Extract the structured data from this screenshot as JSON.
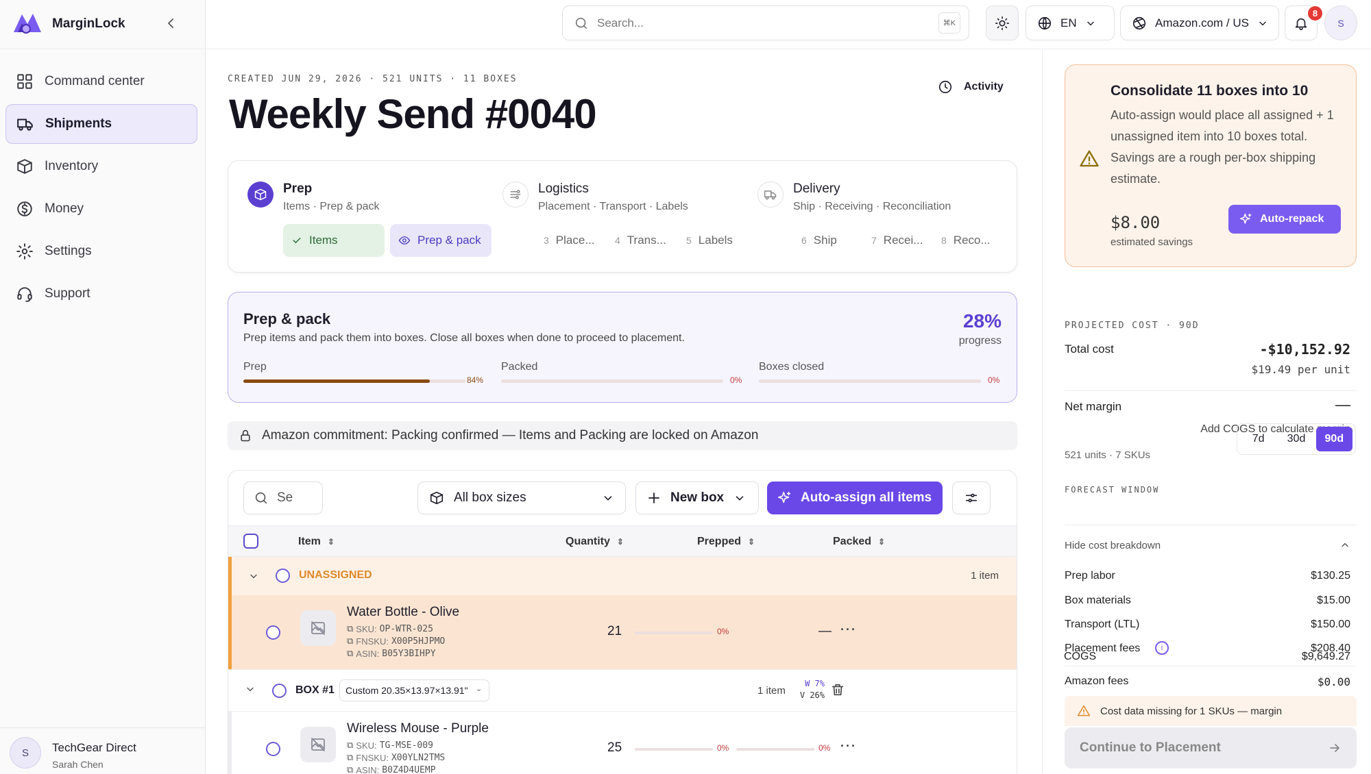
{
  "brand": {
    "name": "MarginLock"
  },
  "nav": {
    "items": [
      {
        "label": "Command center",
        "icon": "grid-icon"
      },
      {
        "label": "Shipments",
        "icon": "truck-icon",
        "active": true
      },
      {
        "label": "Inventory",
        "icon": "box-icon"
      },
      {
        "label": "Money",
        "icon": "dollar-icon"
      },
      {
        "label": "Settings",
        "icon": "gear-icon"
      },
      {
        "label": "Support",
        "icon": "headset-icon"
      }
    ]
  },
  "workspace": {
    "initial": "S",
    "name": "TechGear Direct",
    "user": "Sarah Chen"
  },
  "topbar": {
    "search_placeholder": "Search...",
    "search_kbd": "⌘K",
    "language": "EN",
    "marketplace": "Amazon.com / US",
    "notifications": "8",
    "user_initial": "S"
  },
  "shipment": {
    "meta": "CREATED JUN 29, 2026 · 521 UNITS · 11 BOXES",
    "title": "Weekly Send #0040",
    "activity_label": "Activity"
  },
  "stepper": {
    "stages": [
      {
        "title": "Prep",
        "sub": "Items · Prep & pack"
      },
      {
        "title": "Logistics",
        "sub": "Placement · Transport · Labels"
      },
      {
        "title": "Delivery",
        "sub": "Ship · Receiving · Reconciliation"
      }
    ],
    "steps": [
      {
        "num": "",
        "label": "Items",
        "state": "done"
      },
      {
        "num": "",
        "label": "Prep & pack",
        "state": "current"
      },
      {
        "num": "3",
        "label": "Place..."
      },
      {
        "num": "4",
        "label": "Trans..."
      },
      {
        "num": "5",
        "label": "Labels"
      },
      {
        "num": "6",
        "label": "Ship"
      },
      {
        "num": "7",
        "label": "Recei..."
      },
      {
        "num": "8",
        "label": "Reco..."
      }
    ]
  },
  "prep_pack": {
    "title": "Prep & pack",
    "description": "Prep items and pack them into boxes. Close all boxes when done to proceed to placement.",
    "percent": "28%",
    "percent_label": "progress",
    "bars": [
      {
        "label": "Prep",
        "value": 0.84,
        "display": "84%"
      },
      {
        "label": "Packed",
        "value": 0,
        "display": "0%"
      },
      {
        "label": "Boxes closed",
        "value": 0,
        "display": "0%"
      }
    ]
  },
  "commitment": "Amazon commitment: Packing confirmed — Items and Packing are locked on Amazon",
  "toolbar": {
    "search_value": "Se",
    "box_sizes": "All box sizes",
    "new_box": "New box",
    "auto_assign": "Auto-assign all items"
  },
  "table": {
    "headers": [
      "Item",
      "Quantity",
      "Prepped",
      "Packed"
    ],
    "unassigned": {
      "label": "UNASSIGNED",
      "count": "1 item"
    },
    "rows_unassigned": [
      {
        "name": "Water Bottle - Olive",
        "sku": "OP-WTR-025",
        "fnsku": "X00P5HJPMO",
        "asin": "B05Y3BIHPY",
        "qty": "21",
        "prepped": "0%",
        "packed": "—"
      }
    ],
    "box1": {
      "label": "BOX #1",
      "size": "Custom 20.35×13.97×13.91\"",
      "count": "1 item",
      "w": "W 7%",
      "v": "V 26%"
    },
    "rows_box1": [
      {
        "name": "Wireless Mouse - Purple",
        "sku": "TG-MSE-009",
        "fnsku": "X00YLN2TMS",
        "asin": "B0Z4D4UEMP",
        "qty": "25",
        "prepped": "0%",
        "packed": "0%"
      }
    ],
    "labels": {
      "sku": "SKU:",
      "fnsku": "FNSKU:",
      "asin": "ASIN:"
    }
  },
  "consolidate": {
    "title": "Consolidate 11 boxes into 10",
    "body": "Auto-assign would place all assigned + 1 unassigned item into 10 boxes total. Savings are a rough per-box shipping estimate.",
    "savings": "$8.00",
    "savings_label": "estimated savings",
    "button": "Auto-repack"
  },
  "cost": {
    "projected_label": "PROJECTED COST · 90D",
    "total_label": "Total cost",
    "total_value": "-$10,152.92",
    "per_unit": "$19.49 per unit",
    "margin_label": "Net margin",
    "margin_value": "—",
    "margin_note": "Add COGS to calculate margin",
    "units_skus": "521 units · 7 SKUs",
    "forecast_label": "FORECAST WINDOW",
    "forecast_options": [
      "7d",
      "30d",
      "90d"
    ],
    "forecast_selected": "90d",
    "breakdown_toggle": "Hide cost breakdown",
    "breakdown": [
      {
        "label": "Prep labor",
        "value": "$130.25"
      },
      {
        "label": "Box materials",
        "value": "$15.00"
      },
      {
        "label": "Transport (LTL)",
        "value": "$150.00"
      },
      {
        "label": "Placement fees",
        "value": "$208.40"
      },
      {
        "label": "Amazon fees",
        "value": "$0.00"
      },
      {
        "label": "COGS",
        "value": "$9,649.27"
      }
    ],
    "missing_warning": "Cost data missing for 1 SKUs — margin",
    "continue_button": "Continue to Placement"
  },
  "colors": {
    "accent": "#6a48e8",
    "warning": "#f0a040",
    "prep_bar": "#8a4a12"
  }
}
